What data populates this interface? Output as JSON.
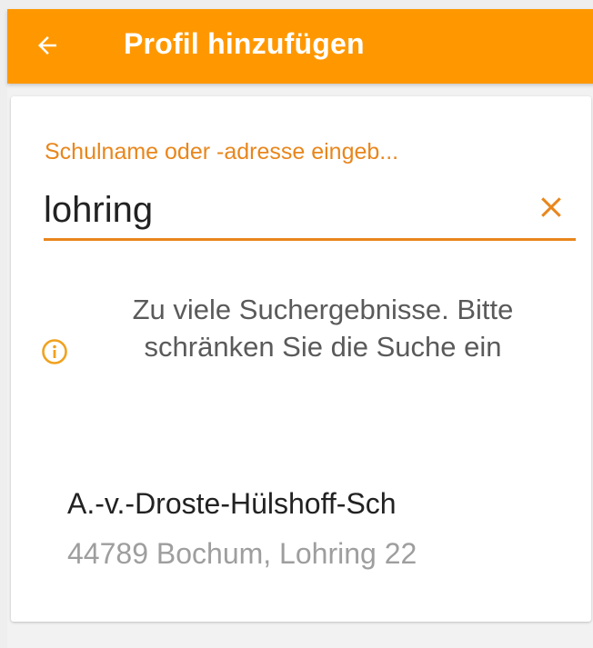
{
  "app_bar": {
    "title": "Profil hinzufügen",
    "back_icon": "arrow-left-icon",
    "background_color": "#ff9800"
  },
  "search": {
    "label": "Schulname oder -adresse eingeb...",
    "value": "lohring",
    "clear_icon": "close-icon",
    "accent_color": "#e8861c"
  },
  "info": {
    "icon": "info-circle-icon",
    "message": "Zu viele Suchergebnisse. Bitte schränken Sie die Suche ein"
  },
  "results": [
    {
      "name": "A.-v.-Droste-Hülshoff-Sch",
      "address": "44789 Bochum, Lohring 22"
    }
  ]
}
